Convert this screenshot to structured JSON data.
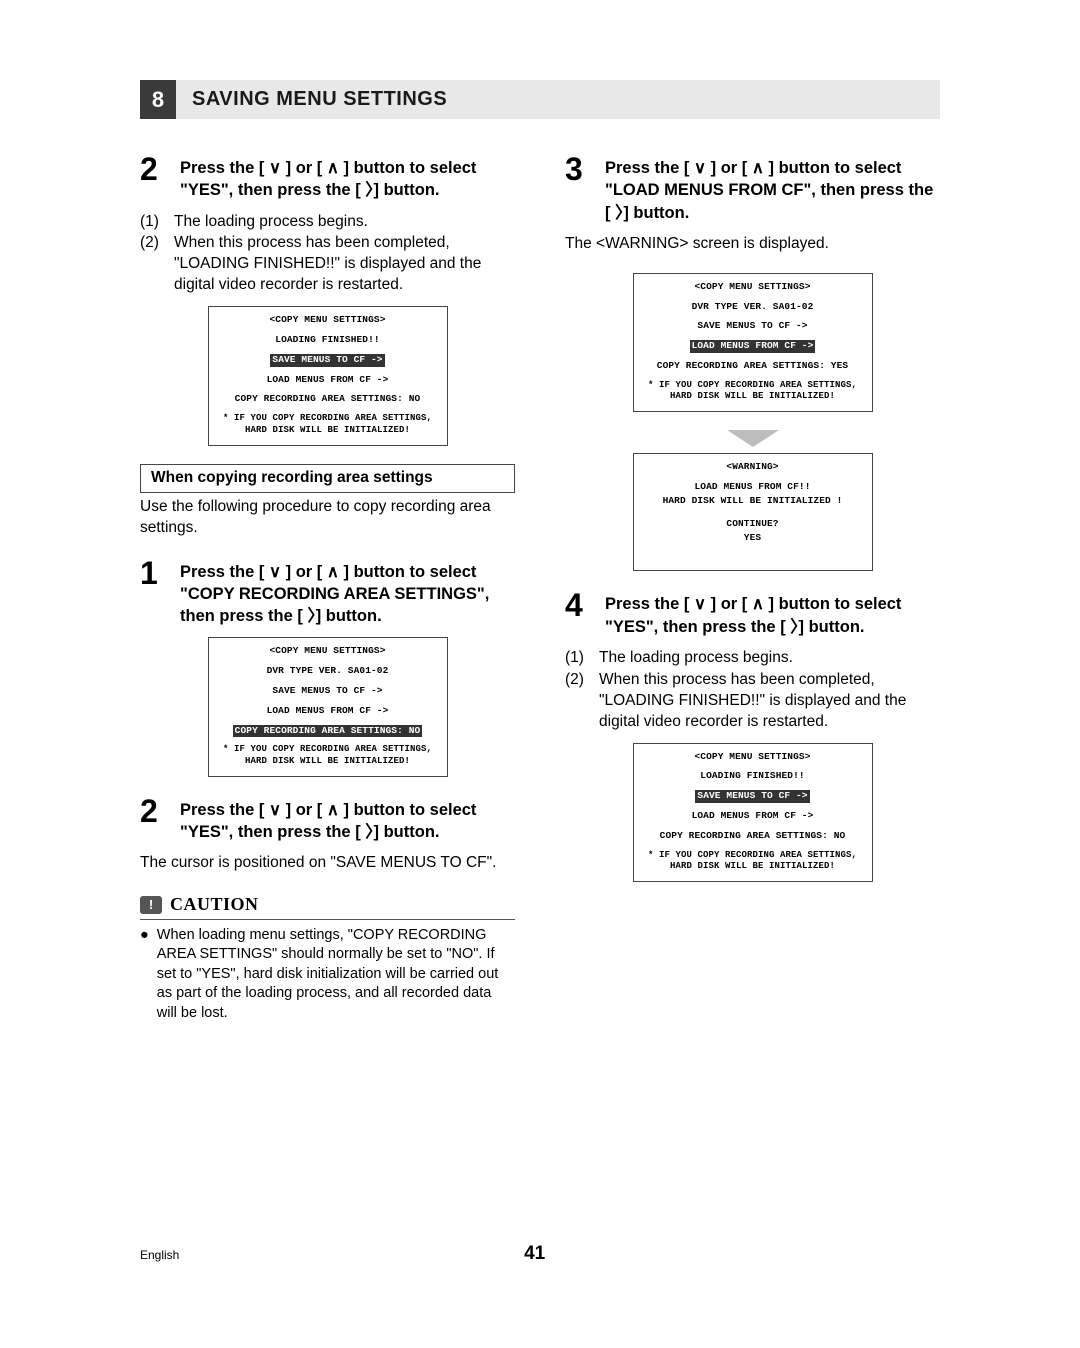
{
  "section": {
    "number": "8",
    "title": "SAVING MENU SETTINGS"
  },
  "left": {
    "step2": "Press the [ ∨ ] or [ ∧ ] button to select \"YES\", then press the [ 〉] button.",
    "lp1n": "(1)",
    "lp1": "The loading process begins.",
    "lp2n": "(2)",
    "lp2": "When this process has been completed, \"LOADING FINISHED!!\" is displayed and the digital video recorder is restarted.",
    "menu1": {
      "title": "<COPY MENU SETTINGS>",
      "r1": "LOADING FINISHED!!",
      "hl": "SAVE MENUS TO CF        ->",
      "r3": "LOAD MENUS FROM CF        ->",
      "r4": "COPY RECORDING AREA SETTINGS: NO",
      "note1": "* IF YOU COPY RECORDING AREA SETTINGS,",
      "note2": "HARD DISK WILL BE INITIALIZED!"
    },
    "subhead": "When copying recording area settings",
    "subtext": "Use the following procedure to copy recording area settings.",
    "step1": "Press the [ ∨ ] or [ ∧ ] button to select \"COPY RECORDING AREA SETTINGS\", then press the [ 〉] button.",
    "menu2": {
      "title": "<COPY MENU SETTINGS>",
      "r1": "DVR TYPE VER. SA01-02",
      "r2": "SAVE MENUS TO CF        ->",
      "r3": "LOAD MENUS FROM CF        ->",
      "hl": "COPY RECORDING AREA SETTINGS: NO",
      "note1": "* IF YOU COPY RECORDING AREA SETTINGS,",
      "note2": "HARD DISK WILL BE INITIALIZED!"
    },
    "step2b": "Press the [ ∨ ] or [ ∧ ] button to select \"YES\", then press the [ 〉] button.",
    "cursor_text": "The cursor is positioned on \"SAVE MENUS TO CF\".",
    "caution_title": "CAUTION",
    "caution_body": "When loading menu settings, \"COPY RECORDING AREA SETTINGS\" should normally be set to \"NO\". If set to \"YES\", hard disk initialization will be carried out as part of the loading process, and all recorded data will be lost."
  },
  "right": {
    "step3": "Press the [ ∨ ] or [ ∧ ] button to select \"LOAD MENUS FROM CF\", then press the [ 〉] button.",
    "warn_text": "The <WARNING> screen is displayed.",
    "menu3": {
      "title": "<COPY MENU SETTINGS>",
      "r1": "DVR TYPE VER. SA01-02",
      "r2": "SAVE MENUS TO CF        ->",
      "hl": "LOAD MENUS FROM CF        ->",
      "r4": "COPY RECORDING AREA SETTINGS: YES",
      "note1": "* IF YOU COPY RECORDING AREA SETTINGS,",
      "note2": "HARD DISK WILL BE INITIALIZED!"
    },
    "menu_warn": {
      "title": "<WARNING>",
      "r1": "LOAD MENUS FROM CF!!",
      "r2": "HARD DISK WILL BE INITIALIZED !",
      "r3": "CONTINUE?",
      "r4": "YES"
    },
    "step4": "Press the [ ∨ ] or [ ∧ ] button to select \"YES\", then press the [ 〉] button.",
    "lp1n": "(1)",
    "lp1": "The loading process begins.",
    "lp2n": "(2)",
    "lp2": "When this process has been completed, \"LOADING FINISHED!!\" is displayed and the digital video recorder is restarted.",
    "menu4": {
      "title": "<COPY MENU SETTINGS>",
      "r1": "LOADING FINISHED!!",
      "hl": "SAVE MENUS TO CF        ->",
      "r3": "LOAD MENUS FROM CF        ->",
      "r4": "COPY RECORDING AREA SETTINGS: NO",
      "note1": "* IF YOU COPY RECORDING AREA SETTINGS,",
      "note2": "HARD DISK WILL BE INITIALIZED!"
    }
  },
  "footer": {
    "lang": "English",
    "page": "41"
  }
}
